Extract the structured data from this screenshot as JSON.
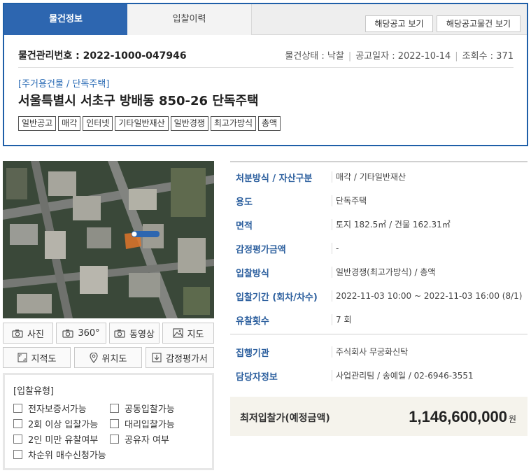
{
  "tabs": [
    {
      "label": "물건정보"
    },
    {
      "label": "입찰이력"
    }
  ],
  "top_buttons": {
    "notice": "해당공고 보기",
    "notice_items": "해당공고물건 보기"
  },
  "info": {
    "mgmt_no": "물건관리번호 : 2022-1000-047946",
    "status": "물건상태 : 낙찰",
    "notice_date": "공고일자 : 2022-10-14",
    "views": "조회수 : 371"
  },
  "category": "[주거용건물 / 단독주택]",
  "address": "서울특별시 서초구 방배동 850-26 단독주택",
  "tags": [
    "일반공고",
    "매각",
    "인터넷",
    "기타일반재산",
    "일반경쟁",
    "최고가방식",
    "총액"
  ],
  "media_buttons": {
    "photo": "사진",
    "view360": "360°",
    "video": "동영상",
    "map": "지도",
    "cadastral": "지적도",
    "location": "위치도",
    "appraisal": "감정평가서"
  },
  "bid_type": {
    "title": "[입찰유형]",
    "options": [
      "전자보증서가능",
      "공동입찰가능",
      "2회 이상 입찰가능",
      "대리입찰가능",
      "2인 미만 유찰여부",
      "공유자 여부",
      "차순위 매수신청가능"
    ]
  },
  "details": [
    {
      "label": "처분방식 / 자산구분",
      "value": "매각 / 기타일반재산"
    },
    {
      "label": "용도",
      "value": "단독주택"
    },
    {
      "label": "면적",
      "value": "토지 182.5㎡ / 건물 162.31㎡"
    },
    {
      "label": "감정평가금액",
      "value": "-"
    },
    {
      "label": "입찰방식",
      "value": "일반경쟁(최고가방식) / 총액"
    },
    {
      "label": "입찰기간 (회차/차수)",
      "value": "2022-11-03 10:00 ~ 2022-11-03 16:00 (8/1)"
    },
    {
      "label": "유찰횟수",
      "value": "7 회"
    },
    {
      "label": "집행기관",
      "value": "주식회사 무궁화신탁"
    },
    {
      "label": "담당자정보",
      "value": "사업관리팀 / 송예일 / 02-6946-3551"
    }
  ],
  "price": {
    "label": "최저입찰가(예정금액)",
    "value": "1,146,600,000",
    "unit": "원"
  },
  "colors": {
    "accent": "#2d66b0",
    "label_blue": "#2c5f9e",
    "price_bg": "#f5f3ec"
  }
}
